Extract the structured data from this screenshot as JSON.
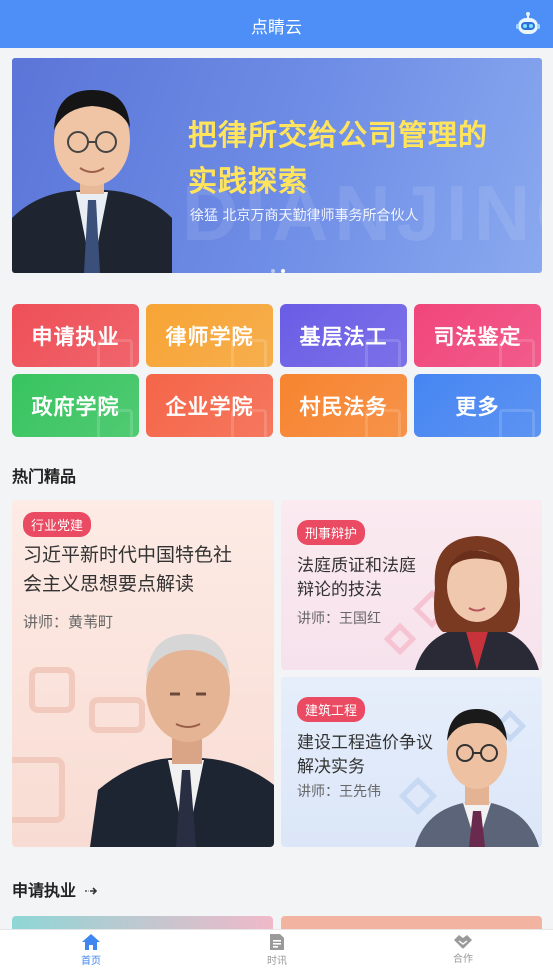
{
  "header": {
    "title": "点睛云"
  },
  "banner": {
    "line1": "把律所交给公司管理的",
    "line2": "实践探索",
    "subtitle": "徐猛 北京万商天勤律师事务所合伙人",
    "watermark": "DIANJING"
  },
  "categories": [
    {
      "label": "申请执业",
      "color": "#ef4f57"
    },
    {
      "label": "律师学院",
      "color": "#f7a434"
    },
    {
      "label": "基层法工",
      "color": "#6a5de6"
    },
    {
      "label": "司法鉴定",
      "color": "#f1457b"
    },
    {
      "label": "政府学院",
      "color": "#38c45f"
    },
    {
      "label": "企业学院",
      "color": "#f56548"
    },
    {
      "label": "村民法务",
      "color": "#f7842f"
    },
    {
      "label": "更多",
      "color": "#4685f2"
    }
  ],
  "hot": {
    "title": "热门精品",
    "cards": [
      {
        "tag": "行业党建",
        "title1": "习近平新时代中国特色社",
        "title2": "会主义思想要点解读",
        "lecturer": "讲师：黄苇町"
      },
      {
        "tag": "刑事辩护",
        "title1": "法庭质证和法庭",
        "title2": "辩论的技法",
        "lecturer": "讲师：王国红"
      },
      {
        "tag": "建筑工程",
        "title1": "建设工程造价争议",
        "title2": "解决实务",
        "lecturer": "讲师：王先伟"
      }
    ]
  },
  "apply_section": {
    "title": "申请执业"
  },
  "tabbar": {
    "items": [
      {
        "label": "首页"
      },
      {
        "label": "时讯"
      },
      {
        "label": "合作"
      }
    ]
  },
  "colors": {
    "primary": "#4d8ff7",
    "tag": "#ea4a62",
    "banner_headline": "#ffe45c"
  }
}
